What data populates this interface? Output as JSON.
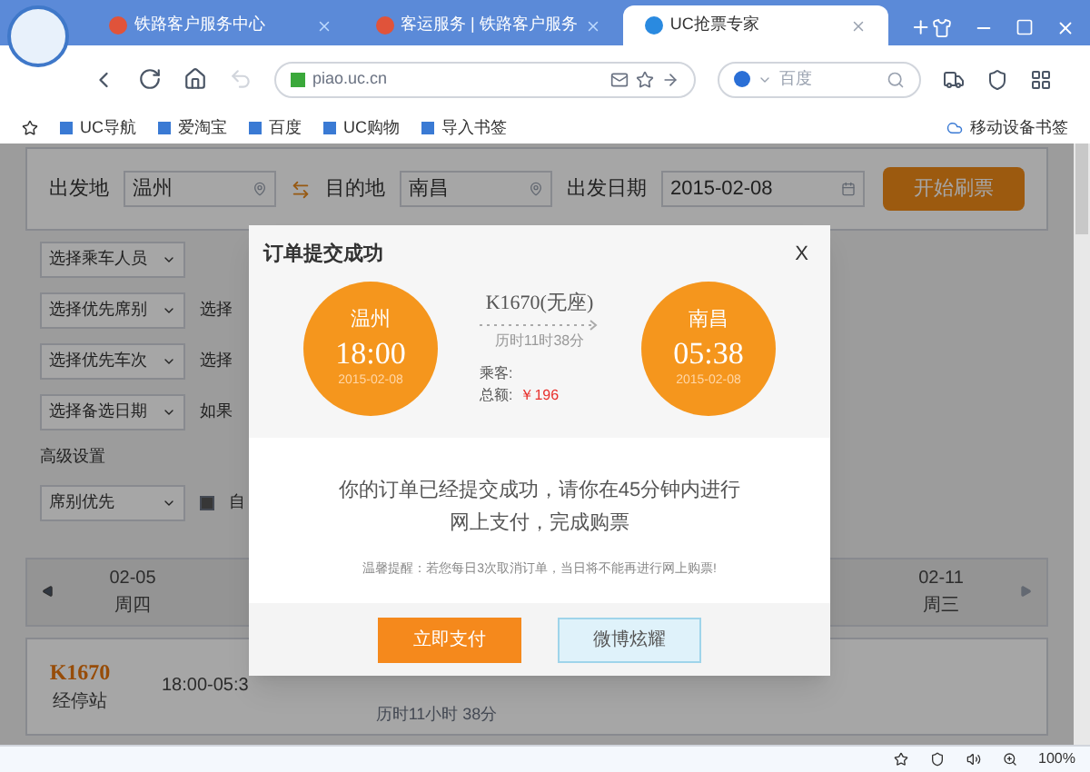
{
  "browser": {
    "tabs": [
      {
        "label": "铁路客户服务中心",
        "selected": false
      },
      {
        "label": "客运服务 | 铁路客户服务",
        "selected": false
      },
      {
        "label": "UC抢票专家",
        "selected": true
      }
    ],
    "address": "piao.uc.cn",
    "search_placeholder": "百度",
    "bookmarks": [
      "UC导航",
      "爱淘宝",
      "百度",
      "UC购物",
      "导入书签"
    ],
    "mobile_bookmarks": "移动设备书签",
    "zoom": "100%"
  },
  "search_form": {
    "from_label": "出发地",
    "from": "温州",
    "to_label": "目的地",
    "to": "南昌",
    "date_label": "出发日期",
    "date": "2015-02-08",
    "button": "开始刷票"
  },
  "options": [
    {
      "select": "选择乘车人员"
    },
    {
      "select": "选择优先席别",
      "note": "选择"
    },
    {
      "select": "选择优先车次",
      "note": "选择"
    },
    {
      "select": "选择备选日期",
      "note": "如果"
    }
  ],
  "advanced": {
    "label": "高级设置",
    "select": "席别优先",
    "checkbox_label": "自",
    "checked": true
  },
  "dates": [
    {
      "date": "02-05",
      "weekday": "周四"
    },
    {
      "date": "02-11",
      "weekday": "周三"
    }
  ],
  "train_row": {
    "train": "K1670",
    "stops": "经停站",
    "time": "18:00-05:3",
    "duration": "历时11小时 38分"
  },
  "dialog": {
    "title": "订单提交成功",
    "close": "X",
    "from": {
      "city": "温州",
      "time": "18:00",
      "date": "2015-02-08"
    },
    "to": {
      "city": "南昌",
      "time": "05:38",
      "date": "2015-02-08"
    },
    "train": "K1670(无座)",
    "duration": "历时11时38分",
    "passenger_label": "乘客:",
    "total_label": "总额:",
    "total": "￥196",
    "message": "你的订单已经提交成功，请你在45分钟内进行网上支付，完成购票",
    "reminder": "温馨提醒：若您每日3次取消订单，当日将不能再进行网上购票!",
    "buttons": [
      {
        "label": "立即支付",
        "kind": "primary"
      },
      {
        "label": "微博炫耀",
        "kind": "secondary"
      }
    ]
  }
}
